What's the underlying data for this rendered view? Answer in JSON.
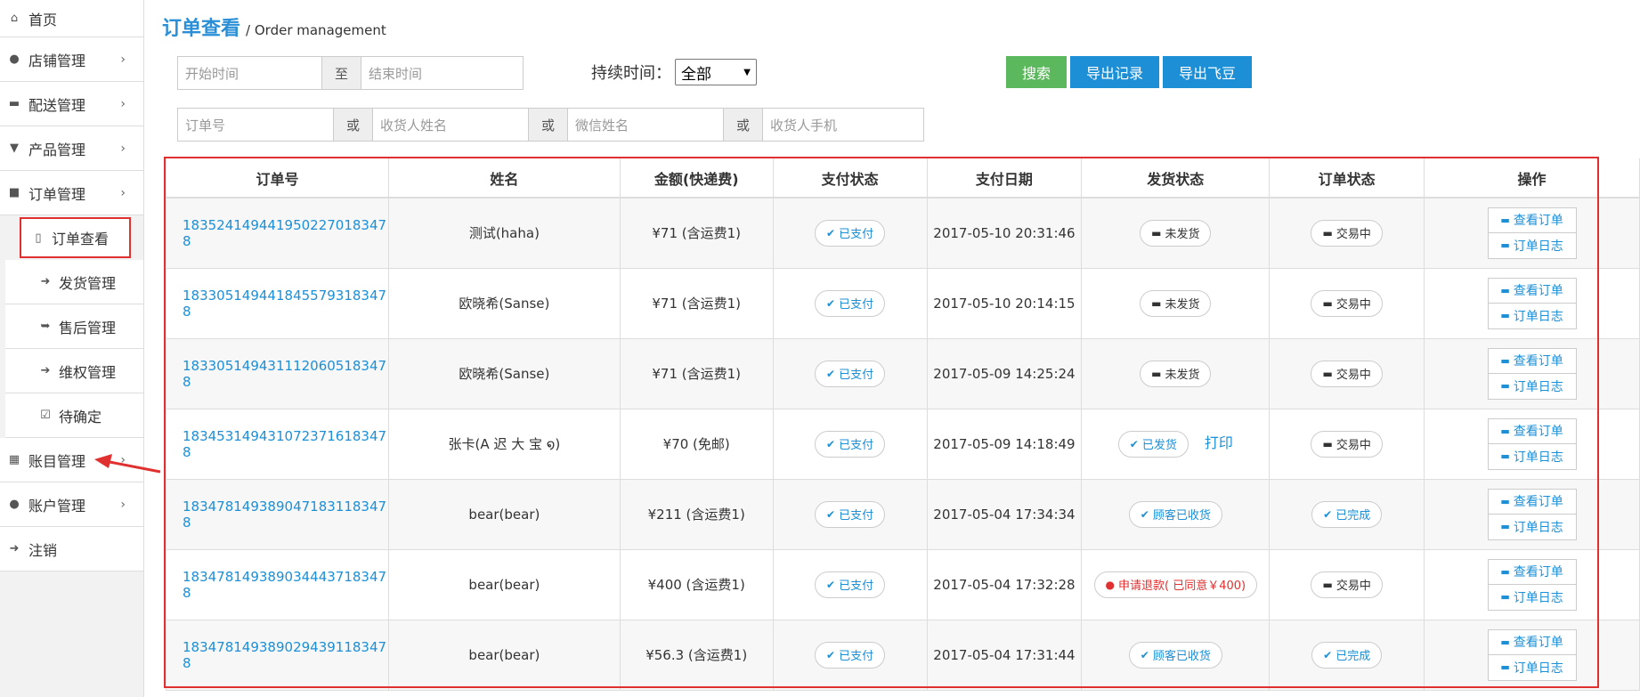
{
  "sidebar": {
    "items": [
      {
        "icon": "home-icon",
        "glyph": "⌂",
        "label": "首页"
      },
      {
        "icon": "user-icon",
        "glyph": "●",
        "label": "店铺管理"
      },
      {
        "icon": "truck-icon",
        "glyph": "▬",
        "label": "配送管理"
      },
      {
        "icon": "cart-icon",
        "glyph": "▼",
        "label": "产品管理"
      },
      {
        "icon": "briefcase-icon",
        "glyph": "■",
        "label": "订单管理"
      }
    ],
    "sub_items": [
      {
        "icon": "document-icon",
        "glyph": "▯",
        "label": "订单查看"
      },
      {
        "icon": "export-icon",
        "glyph": "➜",
        "label": "发货管理"
      },
      {
        "icon": "reply-icon",
        "glyph": "➥",
        "label": "售后管理"
      },
      {
        "icon": "forward-icon",
        "glyph": "➔",
        "label": "维权管理"
      },
      {
        "icon": "check-square-icon",
        "glyph": "☑",
        "label": "待确定"
      }
    ],
    "items_after": [
      {
        "icon": "table-icon",
        "glyph": "▦",
        "label": "账目管理"
      },
      {
        "icon": "user-icon",
        "glyph": "●",
        "label": "账户管理"
      },
      {
        "icon": "logout-icon",
        "glyph": "➜",
        "label": "注销"
      }
    ]
  },
  "header": {
    "title": "订单查看",
    "separator": "/",
    "subtitle": "Order management"
  },
  "filters": {
    "start_time": "开始时间",
    "to": "至",
    "end_time": "结束时间",
    "duration_label": "持续时间：",
    "duration_value": "全部",
    "search": "搜索",
    "export_records": "导出记录",
    "export_feidou": "导出飞豆",
    "order_no": "订单号",
    "or": "或",
    "receiver_name": "收货人姓名",
    "wechat_name": "微信姓名",
    "receiver_phone": "收货人手机"
  },
  "table": {
    "headers": [
      "订单号",
      "姓名",
      "金额(快递费)",
      "支付状态",
      "支付日期",
      "发货状态",
      "订单状态",
      "操作"
    ],
    "view_order": "查看订单",
    "order_log": "订单日志",
    "print": "打印",
    "rows": [
      {
        "id": "183524149441950227018347​8",
        "name": "测试(haha)",
        "amount": "¥71 (含运费1)",
        "pay": "已支付",
        "date": "2017-05-10 20:31:46",
        "ship": "未发货",
        "ship_type": "dark",
        "status": "交易中",
        "status_type": "dark"
      },
      {
        "id": "183305149441845579318347​8",
        "name": "欧晓希(Sanse)",
        "amount": "¥71 (含运费1)",
        "pay": "已支付",
        "date": "2017-05-10 20:14:15",
        "ship": "未发货",
        "ship_type": "dark",
        "status": "交易中",
        "status_type": "dark"
      },
      {
        "id": "183305149431112060518347​8",
        "name": "欧晓希(Sanse)",
        "amount": "¥71 (含运费1)",
        "pay": "已支付",
        "date": "2017-05-09 14:25:24",
        "ship": "未发货",
        "ship_type": "dark",
        "status": "交易中",
        "status_type": "dark"
      },
      {
        "id": "183453149431072371618347​8",
        "name": "张卡(A 迟 大 宝 ໑)",
        "amount": "¥70 (免邮)",
        "pay": "已支付",
        "date": "2017-05-09 14:18:49",
        "ship": "已发货",
        "ship_type": "blue",
        "status": "交易中",
        "status_type": "dark",
        "printable": true
      },
      {
        "id": "183478149389047183118347​8",
        "name": "bear(bear)",
        "amount": "¥211 (含运费1)",
        "pay": "已支付",
        "date": "2017-05-04 17:34:34",
        "ship": "顾客已收货",
        "ship_type": "blue",
        "status": "已完成",
        "status_type": "blue"
      },
      {
        "id": "183478149389034443718347​8",
        "name": "bear(bear)",
        "amount": "¥400 (含运费1)",
        "pay": "已支付",
        "date": "2017-05-04 17:32:28",
        "ship": "申请退款( 已同意￥400)",
        "ship_type": "red",
        "status": "交易中",
        "status_type": "dark"
      },
      {
        "id": "183478149389029439118347​8",
        "name": "bear(bear)",
        "amount": "¥56.3 (含运费1)",
        "pay": "已支付",
        "date": "2017-05-04 17:31:44",
        "ship": "顾客已收货",
        "ship_type": "blue",
        "status": "已完成",
        "status_type": "blue"
      }
    ]
  },
  "colors": {
    "accent": "#1c8fd6",
    "success": "#5cb85c",
    "highlight": "#e03030"
  }
}
